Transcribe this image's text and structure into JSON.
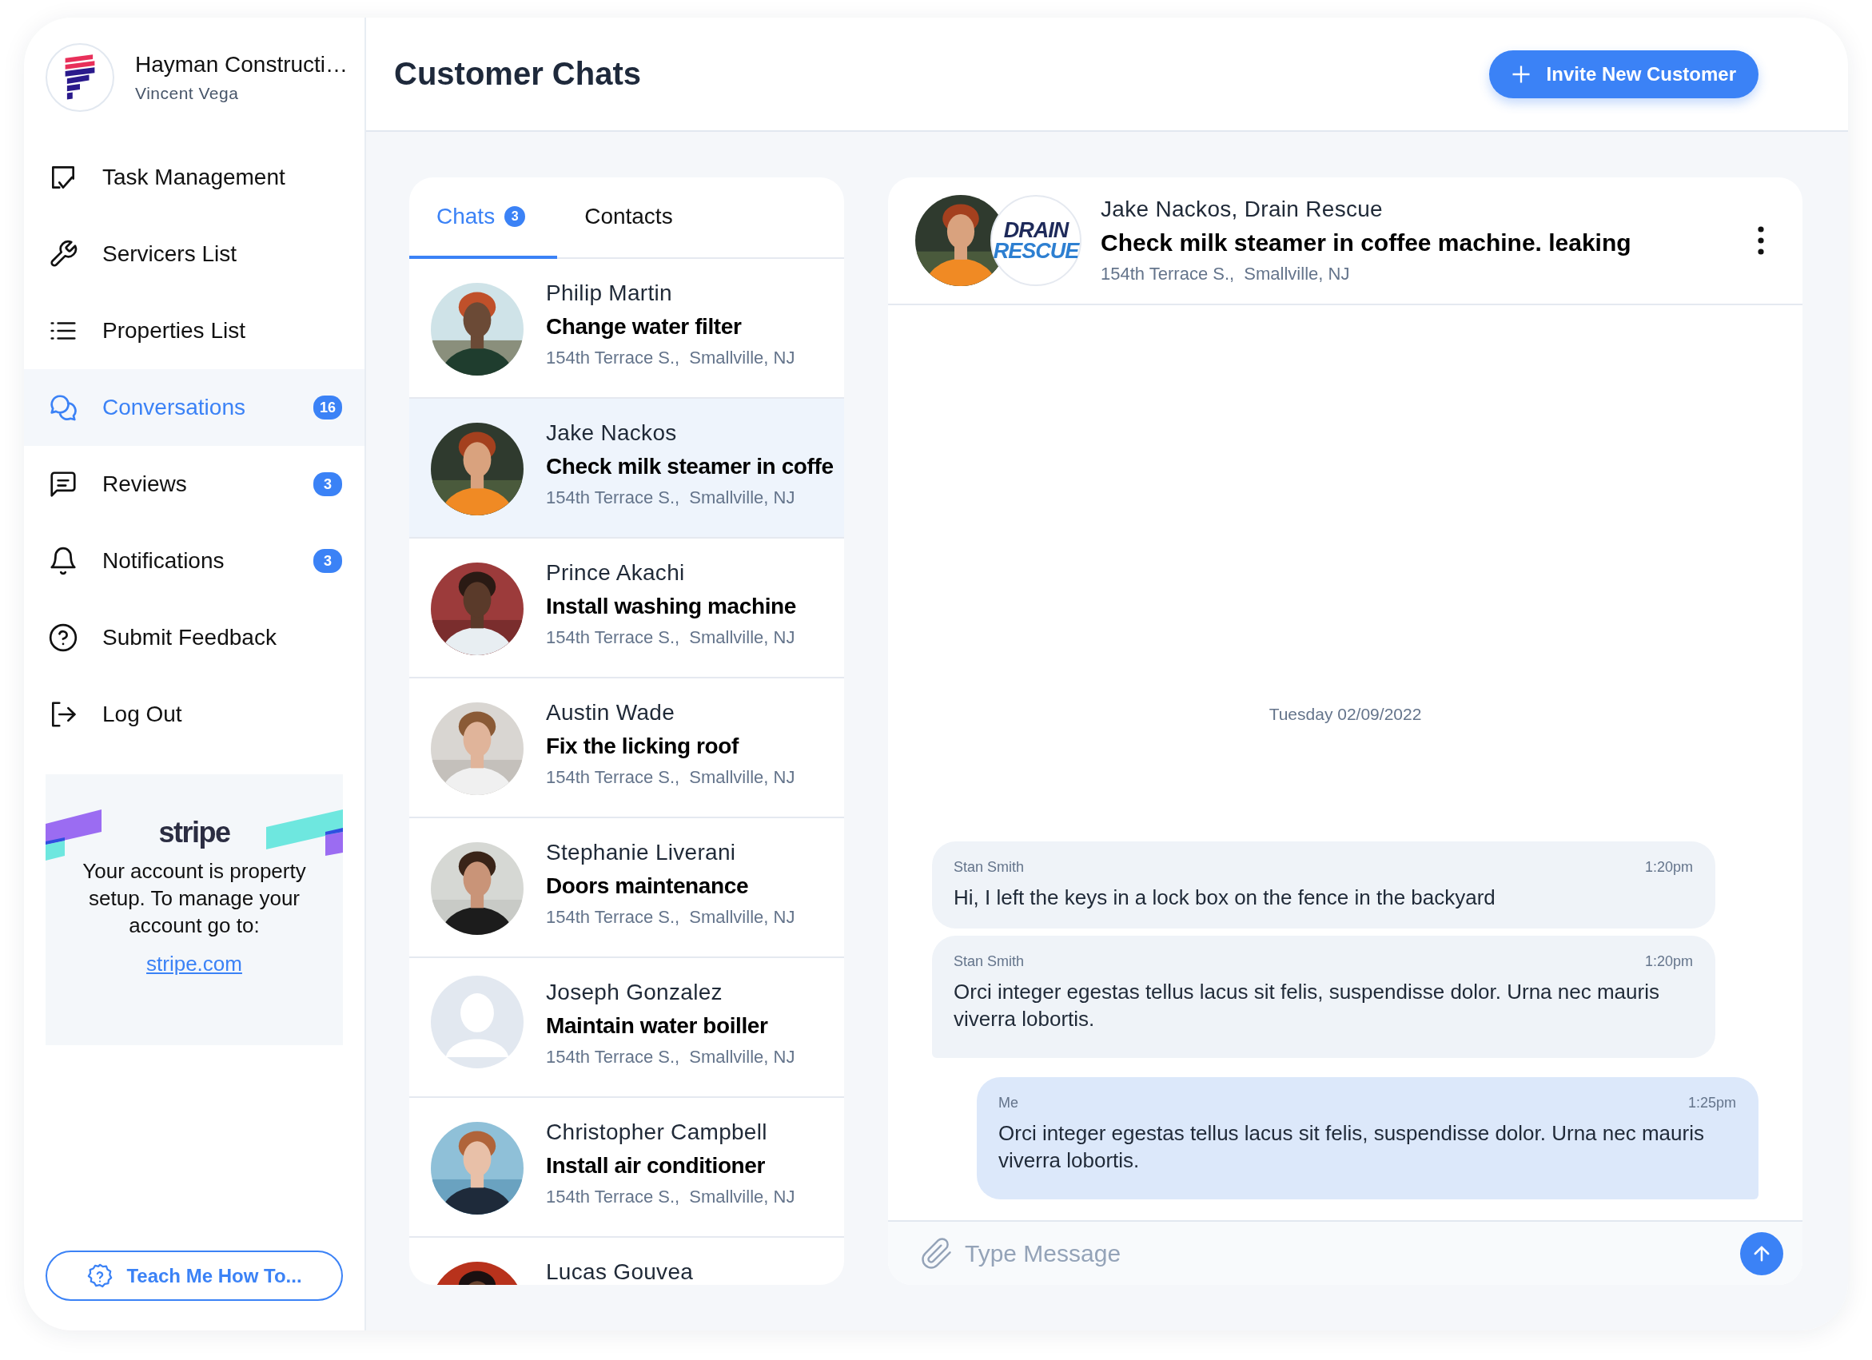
{
  "sidebar": {
    "company": "Hayman Constructi…",
    "user": "Vincent Vega",
    "nav": [
      {
        "label": "Task Management",
        "selected": false
      },
      {
        "label": "Servicers List",
        "selected": false
      },
      {
        "label": "Properties List",
        "selected": false
      },
      {
        "label": "Conversations",
        "selected": true,
        "badge": "16"
      },
      {
        "label": "Reviews",
        "selected": false,
        "badge": "3"
      },
      {
        "label": "Notifications",
        "selected": false,
        "badge": "3"
      },
      {
        "label": "Submit Feedback",
        "selected": false
      },
      {
        "label": "Log Out",
        "selected": false
      }
    ],
    "stripe_card": {
      "logo": "stripe",
      "text": "Your account is property setup. To manage your account go to:",
      "link": "stripe.com"
    },
    "help_button": "Teach Me How To..."
  },
  "header": {
    "title": "Customer Chats",
    "invite_button": "Invite New Customer"
  },
  "chat_list": {
    "tabs": [
      {
        "label": "Chats",
        "badge": "3",
        "selected": true
      },
      {
        "label": "Contacts",
        "selected": false
      }
    ],
    "chats": [
      {
        "name": "Philip Martin",
        "title": "Change water filter",
        "address": "154th Terrace S.,  Smallville, NJ",
        "selected": false,
        "kind": "picture"
      },
      {
        "name": "Jake Nackos",
        "title": "Check milk steamer in coffe",
        "address": "154th Terrace S.,  Smallville, NJ",
        "selected": true,
        "kind": "picture"
      },
      {
        "name": "Prince Akachi",
        "title": "Install washing machine",
        "address": "154th Terrace S.,  Smallville, NJ",
        "selected": false,
        "kind": "picture"
      },
      {
        "name": "Austin Wade",
        "title": "Fix the licking roof",
        "address": "154th Terrace S.,  Smallville, NJ",
        "selected": false,
        "kind": "picture"
      },
      {
        "name": "Stephanie Liverani",
        "title": "Doors maintenance",
        "address": "154th Terrace S.,  Smallville, NJ",
        "selected": false,
        "kind": "picture"
      },
      {
        "name": "Joseph Gonzalez",
        "title": "Maintain water boiller",
        "address": "154th Terrace S.,  Smallville, NJ",
        "selected": false,
        "kind": "placeholder"
      },
      {
        "name": "Christopher Campbell",
        "title": "Install air conditioner",
        "address": "154th Terrace S.,  Smallville, NJ",
        "selected": false,
        "kind": "picture"
      },
      {
        "name": "Lucas Gouvea",
        "selected": false,
        "kind": "picture"
      }
    ]
  },
  "conversation": {
    "contact": "Jake Nackos, Drain Rescue",
    "logo_text": [
      "DRAIN",
      "RESCUE"
    ],
    "title": "Check milk steamer in coffee machine. leaking",
    "address": "154th Terrace S.,  Smallville, NJ",
    "date": "Tuesday 02/09/2022",
    "messages": [
      {
        "kind": "incoming",
        "sender": "Stan Smith",
        "time": "1:20pm",
        "text": "Hi, I left the keys in a lock box on the fence in the backyard"
      },
      {
        "kind": "incoming",
        "sender": "Stan Smith",
        "time": "1:20pm",
        "text": "Orci integer egestas tellus lacus sit felis, suspendisse dolor. Urna nec mauris viverra lobortis."
      },
      {
        "kind": "outgoing",
        "sender": "Me",
        "time": "1:25pm",
        "text": "Orci integer egestas tellus lacus sit felis, suspendisse dolor. Urna nec mauris viverra lobortis."
      }
    ],
    "input": {
      "placeholder": "Type Message"
    }
  }
}
